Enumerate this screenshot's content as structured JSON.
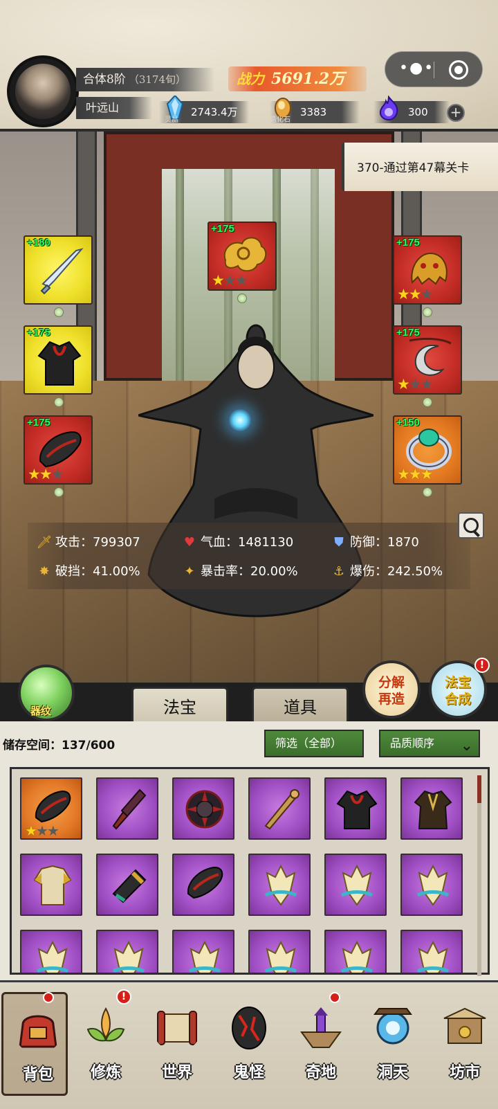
{
  "player": {
    "realm": "合体8阶",
    "realm_sub": "（3174旬）",
    "name": "叶远山",
    "power_label": "战力",
    "power_value": "5691.2万"
  },
  "resources": [
    {
      "icon": "spirit-crystal-icon",
      "caption": "灵晶",
      "value": "2743.4万"
    },
    {
      "icon": "creation-stone-icon",
      "caption": "造化石",
      "value": "3383"
    },
    {
      "icon": "soul-flame-icon",
      "caption": "",
      "value": "300"
    }
  ],
  "quest": {
    "text": "370-通过第47幕关卡"
  },
  "equipment": {
    "slots": [
      {
        "name": "weapon",
        "level": "+180",
        "color": "yellow",
        "stars": 0
      },
      {
        "name": "armor",
        "level": "+175",
        "color": "yellow",
        "stars": 0
      },
      {
        "name": "gloves",
        "level": "+175",
        "color": "red",
        "stars": 2
      },
      {
        "name": "talisman",
        "level": "+175",
        "color": "red",
        "stars": 1
      },
      {
        "name": "beast-helm",
        "level": "+175",
        "color": "red",
        "stars": 2
      },
      {
        "name": "necklace",
        "level": "+175",
        "color": "red",
        "stars": 1
      },
      {
        "name": "ring",
        "level": "+150",
        "color": "orange",
        "stars": 3
      }
    ]
  },
  "stats": {
    "attack": "攻击：799307",
    "hp": "气血：1481130",
    "defense": "防御：1870",
    "pierce": "破挡：41.00%",
    "crit_rate": "暴击率：20.00%",
    "crit_dmg": "爆伤：242.50%"
  },
  "tabs": {
    "orb_label": "器纹",
    "treasure": "法宝",
    "items": "道具",
    "dismantle_line1": "分解",
    "dismantle_line2": "再造",
    "synth_line1": "法宝",
    "synth_line2": "合成",
    "synth_badge": "!"
  },
  "storage": {
    "label": "储存空间：",
    "capacity": "137/600",
    "filter": "筛选（全部）",
    "sort": "品质顺序"
  },
  "nav": [
    {
      "label": "背包",
      "badge": true
    },
    {
      "label": "修炼",
      "badge": true
    },
    {
      "label": "世界",
      "badge": false
    },
    {
      "label": "鬼怪",
      "badge": false
    },
    {
      "label": "奇地",
      "badge": true
    },
    {
      "label": "洞天",
      "badge": false
    },
    {
      "label": "坊市",
      "badge": false
    }
  ],
  "colors": {
    "power_bg": "#e85a2b",
    "legend_red": "#c42d26",
    "epic_purple": "#a04fc4",
    "level_green": "#2cff5a",
    "filter_green": "#3a6d2a"
  }
}
